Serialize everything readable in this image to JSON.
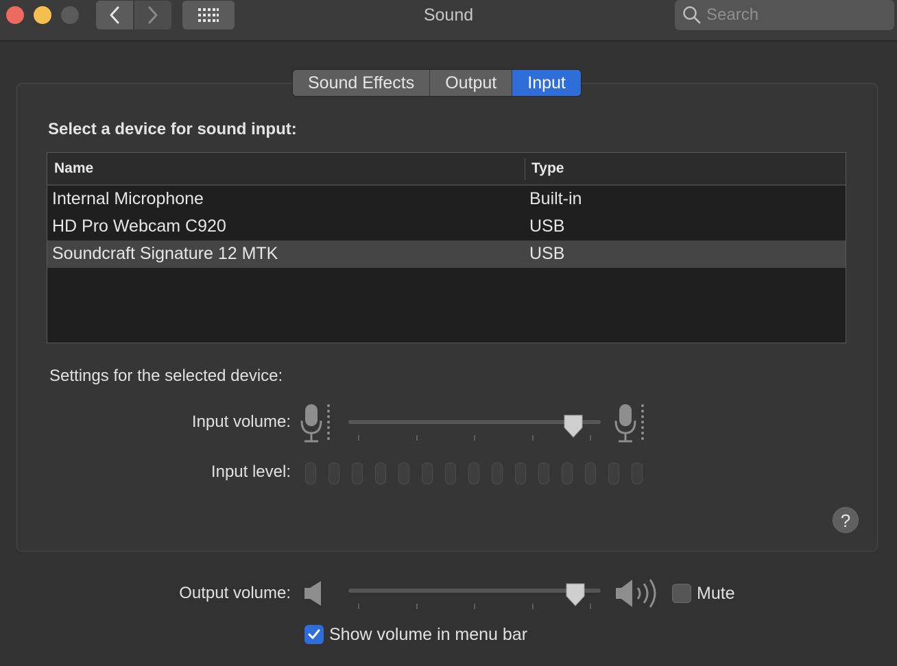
{
  "window": {
    "title": "Sound"
  },
  "toolbar": {
    "back_icon": "chevron-left-icon",
    "forward_icon": "chevron-right-icon",
    "grid_icon": "grid-icon"
  },
  "search": {
    "placeholder": "Search",
    "value": ""
  },
  "tabs": [
    {
      "label": "Sound Effects",
      "active": false
    },
    {
      "label": "Output",
      "active": false
    },
    {
      "label": "Input",
      "active": true
    }
  ],
  "input_panel": {
    "section_title": "Select a device for sound input:",
    "columns": {
      "name": "Name",
      "type": "Type"
    },
    "devices": [
      {
        "name": "Internal Microphone",
        "type": "Built-in",
        "selected": false
      },
      {
        "name": "HD Pro Webcam C920",
        "type": "USB",
        "selected": false
      },
      {
        "name": "Soundcraft Signature 12 MTK",
        "type": "USB",
        "selected": true
      }
    ],
    "settings_title": "Settings for the selected device:",
    "input_volume_label": "Input volume:",
    "input_volume_fraction": 0.89,
    "input_level_label": "Input level:",
    "input_level_segments": 15,
    "input_level_active": 0,
    "help_label": "?"
  },
  "output": {
    "volume_label": "Output volume:",
    "volume_fraction": 0.9,
    "mute_label": "Mute",
    "mute_checked": false,
    "show_in_menu_bar_label": "Show volume in menu bar",
    "show_in_menu_bar_checked": true
  },
  "colors": {
    "accent": "#2f6ed9",
    "close": "#ed6a5e",
    "minimize": "#f5bf4f",
    "zoom_disabled": "#5a5a5a"
  }
}
